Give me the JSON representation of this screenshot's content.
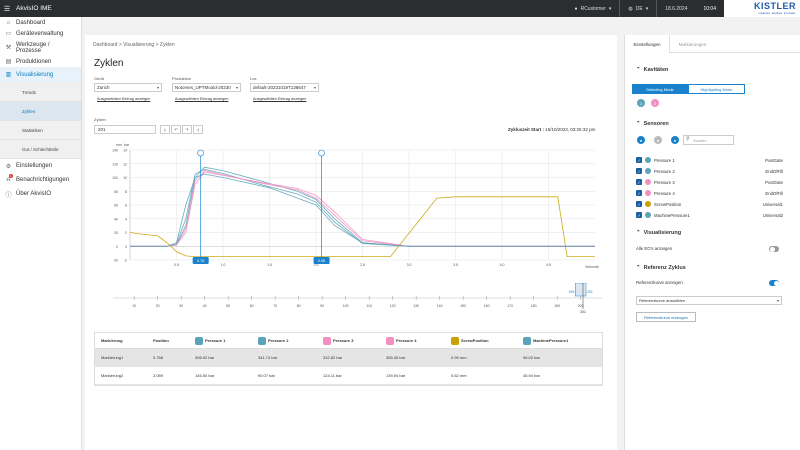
{
  "app": {
    "title": "AkvisIO IME"
  },
  "topbar": {
    "user": "RCustomer",
    "lang": "DE",
    "date": "18.6.2024",
    "time": "10:04",
    "logo": "KISTLER",
    "logo_sub": "measure. analyze. innovate."
  },
  "sidebar": {
    "items": [
      {
        "label": "Dashboard",
        "icon": "house-icon"
      },
      {
        "label": "Geräteverwaltung",
        "icon": "device-icon"
      },
      {
        "label": "Werkzeuge / Prozesse",
        "icon": "wrench-icon"
      },
      {
        "label": "Produktionen",
        "icon": "factory-icon"
      },
      {
        "label": "Visualisierung",
        "icon": "chart-icon"
      },
      {
        "label": "Einstellungen",
        "icon": "gear-icon"
      },
      {
        "label": "Benachrichtigungen",
        "icon": "bell-icon"
      },
      {
        "label": "Über AkvisIO",
        "icon": "info-icon"
      }
    ],
    "sub": [
      "Trends",
      "Zyklen",
      "Statistiken",
      "Gut / Schlechtteile"
    ],
    "notif_count": "1"
  },
  "breadcrumb": "Dashboard > Visualisierung > Zyklen",
  "page_title": "Zyklen",
  "filters": {
    "geraet_label": "Gerät",
    "geraet_value": "Zürich",
    "geraet_link": "Ausgewählten Eintrag anzeigen",
    "produktion_label": "Produktion",
    "produktion_value": "Notomes_UPTMould-20230",
    "produktion_link": "Ausgewählten Eintrag anzeigen",
    "los_label": "Los",
    "los_value": "default-20231019T138647",
    "los_link": "Ausgewählten Eintrag anzeigen"
  },
  "cycle": {
    "label": "Zyklen",
    "value": "201",
    "start_label": "Zykluszeit Start :",
    "start_value": "16/10/2023, 03:25:32 pm"
  },
  "chart": {
    "y_units": [
      "mm",
      "bar"
    ],
    "y_ticks": [
      "140",
      "120",
      "100",
      "80",
      "60",
      "40",
      "20",
      "0",
      "-20"
    ],
    "y2_ticks": [
      "14",
      "12",
      "10",
      "8",
      "6",
      "4",
      "2",
      "0",
      "-2"
    ],
    "x_ticks": [
      "0.5",
      "1.0",
      "1.5",
      "2.0",
      "2.5",
      "3.0",
      "3.5",
      "4.0",
      "4.5"
    ],
    "x_unit": "Sekunde",
    "markers": [
      "0.76",
      "2.06"
    ]
  },
  "chart_data": {
    "type": "line",
    "xlabel": "Sekunde",
    "ylabel": "bar",
    "xlim": [
      0,
      5
    ],
    "ylim": [
      -20,
      140
    ],
    "series": [
      {
        "name": "Pressure 1",
        "x": [
          0,
          0.2,
          0.4,
          0.5,
          0.6,
          0.7,
          0.8,
          1.0,
          1.4,
          1.8,
          2.0,
          2.2,
          2.5,
          3.0,
          4.0,
          5.0
        ],
        "y": [
          0,
          0,
          0,
          2,
          30,
          100,
          115,
          110,
          95,
          80,
          68,
          40,
          5,
          0,
          0,
          0
        ]
      },
      {
        "name": "Pressure 2",
        "x": [
          0,
          0.2,
          0.4,
          0.5,
          0.6,
          0.7,
          0.8,
          1.0,
          1.4,
          1.8,
          2.0,
          2.2,
          2.5,
          3.0,
          4.0,
          5.0
        ],
        "y": [
          0,
          0,
          0,
          3,
          40,
          105,
          112,
          106,
          90,
          76,
          64,
          35,
          4,
          0,
          0,
          0
        ]
      },
      {
        "name": "Pressure 3",
        "x": [
          0,
          0.2,
          0.4,
          0.5,
          0.6,
          0.7,
          0.8,
          1.0,
          1.4,
          1.8,
          2.0,
          2.2,
          2.5,
          3.0,
          4.0,
          5.0
        ],
        "y": [
          0,
          0,
          0,
          2,
          25,
          95,
          110,
          104,
          92,
          82,
          70,
          45,
          8,
          0,
          0,
          0
        ]
      },
      {
        "name": "Pressure 4",
        "x": [
          0,
          0.2,
          0.4,
          0.5,
          0.6,
          0.7,
          0.8,
          1.0,
          1.4,
          1.8,
          2.0,
          2.2,
          2.5,
          3.0,
          4.0,
          5.0
        ],
        "y": [
          0,
          0,
          0,
          2,
          20,
          90,
          108,
          103,
          93,
          84,
          74,
          50,
          10,
          0,
          0,
          0
        ]
      },
      {
        "name": "ScrewPosition",
        "x": [
          0,
          0.1,
          0.3,
          0.4,
          0.5,
          0.6,
          0.7,
          1.0,
          2.0,
          2.5,
          2.8,
          3.3,
          3.5,
          4.6,
          4.7,
          5.0
        ],
        "y": [
          20,
          18,
          15,
          5,
          -8,
          -14,
          -15,
          -15,
          -15,
          -15,
          -15,
          70,
          72,
          72,
          -15,
          -15
        ]
      },
      {
        "name": "MachinePressure1",
        "x": [
          0,
          0.3,
          0.4,
          0.5,
          0.6,
          0.7,
          0.8,
          1.0,
          1.5,
          2.0,
          2.2,
          2.5,
          3.0,
          4.0,
          5.0
        ],
        "y": [
          0,
          0,
          0,
          5,
          60,
          100,
          105,
          100,
          85,
          60,
          30,
          5,
          0,
          0,
          0
        ]
      }
    ]
  },
  "scroller": {
    "ticks": [
      "10",
      "20",
      "30",
      "40",
      "50",
      "60",
      "70",
      "80",
      "90",
      "100",
      "110",
      "120",
      "130",
      "140",
      "150",
      "160",
      "170",
      "180",
      "190",
      "200"
    ],
    "range_start": "199",
    "range_end": "201",
    "cur": "201"
  },
  "table": {
    "headers": [
      "Markierung",
      "Position",
      "Pressure 1",
      "Pressure 2",
      "Pressure 3",
      "Pressure 4",
      "ScrewPosition",
      "MachinePressure1"
    ],
    "rows": [
      [
        "Markierung1",
        "0.768",
        "306.92 bar",
        "341.74 bar",
        "332.82 bar",
        "355.45 bar",
        "0.99 mm",
        "96.02 bar"
      ],
      [
        "Markierung2",
        "2.059",
        "145.50 bar",
        "90.07 bar",
        "124.11 bar",
        "139.94 bar",
        "0.62 mm",
        "45.94 bar"
      ]
    ]
  },
  "right": {
    "tabs": [
      "Einstellungen",
      "Markierungen"
    ],
    "kavitaeten": "Kavitäten",
    "modes": [
      "Selecting Mode",
      "Highlighting Mode"
    ],
    "sensoren": "Sensoren",
    "search_placeholder": "Suchen",
    "sensors": [
      {
        "name": "Pressure 1",
        "unit": "PostGate",
        "color": "#5ba3b8"
      },
      {
        "name": "Pressure 2",
        "unit": "EndOfFill",
        "color": "#5ba3b8"
      },
      {
        "name": "Pressure 3",
        "unit": "PostGate",
        "color": "#f28fc2"
      },
      {
        "name": "Pressure 4",
        "unit": "EndOfFill",
        "color": "#f28fc2"
      },
      {
        "name": "ScrewPosition",
        "unit": "Universal1",
        "color": "#c9a100"
      },
      {
        "name": "MachinePressure1",
        "unit": "Universal2",
        "color": "#5ba3b8"
      }
    ],
    "visualisierung": "Visualisierung",
    "alle_eo": "Alle EO's anzeigen",
    "referenz": "Referenz Zyklus",
    "referenz_toggle": "Referenzkurve anzeigen",
    "referenz_select": "Referenzkurve auswählen",
    "referenz_btn": "Referenzkurve erzeugen",
    "cav": [
      "1",
      "2"
    ]
  }
}
